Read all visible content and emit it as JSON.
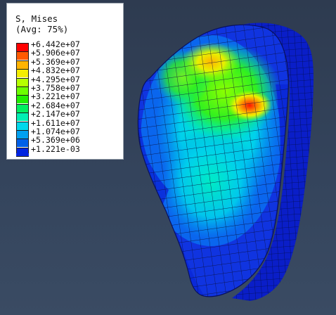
{
  "legend": {
    "title_line1": "S, Mises",
    "title_line2": "(Avg: 75%)",
    "entries": [
      {
        "label": "+6.442e+07",
        "color": "#ff0000"
      },
      {
        "label": "+5.906e+07",
        "color": "#ff5a00"
      },
      {
        "label": "+5.369e+07",
        "color": "#ffb400"
      },
      {
        "label": "+4.832e+07",
        "color": "#f4ee00"
      },
      {
        "label": "+4.295e+07",
        "color": "#b6ff00"
      },
      {
        "label": "+3.758e+07",
        "color": "#6cff00"
      },
      {
        "label": "+3.221e+07",
        "color": "#20f000"
      },
      {
        "label": "+2.684e+07",
        "color": "#00f060"
      },
      {
        "label": "+2.147e+07",
        "color": "#00f0b4"
      },
      {
        "label": "+1.611e+07",
        "color": "#00d8ec"
      },
      {
        "label": "+1.074e+07",
        "color": "#00a0f0"
      },
      {
        "label": "+5.369e+06",
        "color": "#0060e8"
      },
      {
        "label": "+1.221e-03",
        "color": "#0024e0"
      }
    ]
  },
  "model": {
    "icon": "stress-contour-mesh-model",
    "colors": {
      "background": "#2f3e55",
      "max_stress": "#ff2200",
      "high": "#c8f000",
      "mid": "#30e060",
      "low": "#00c8e8",
      "min": "#0a20d0"
    }
  }
}
